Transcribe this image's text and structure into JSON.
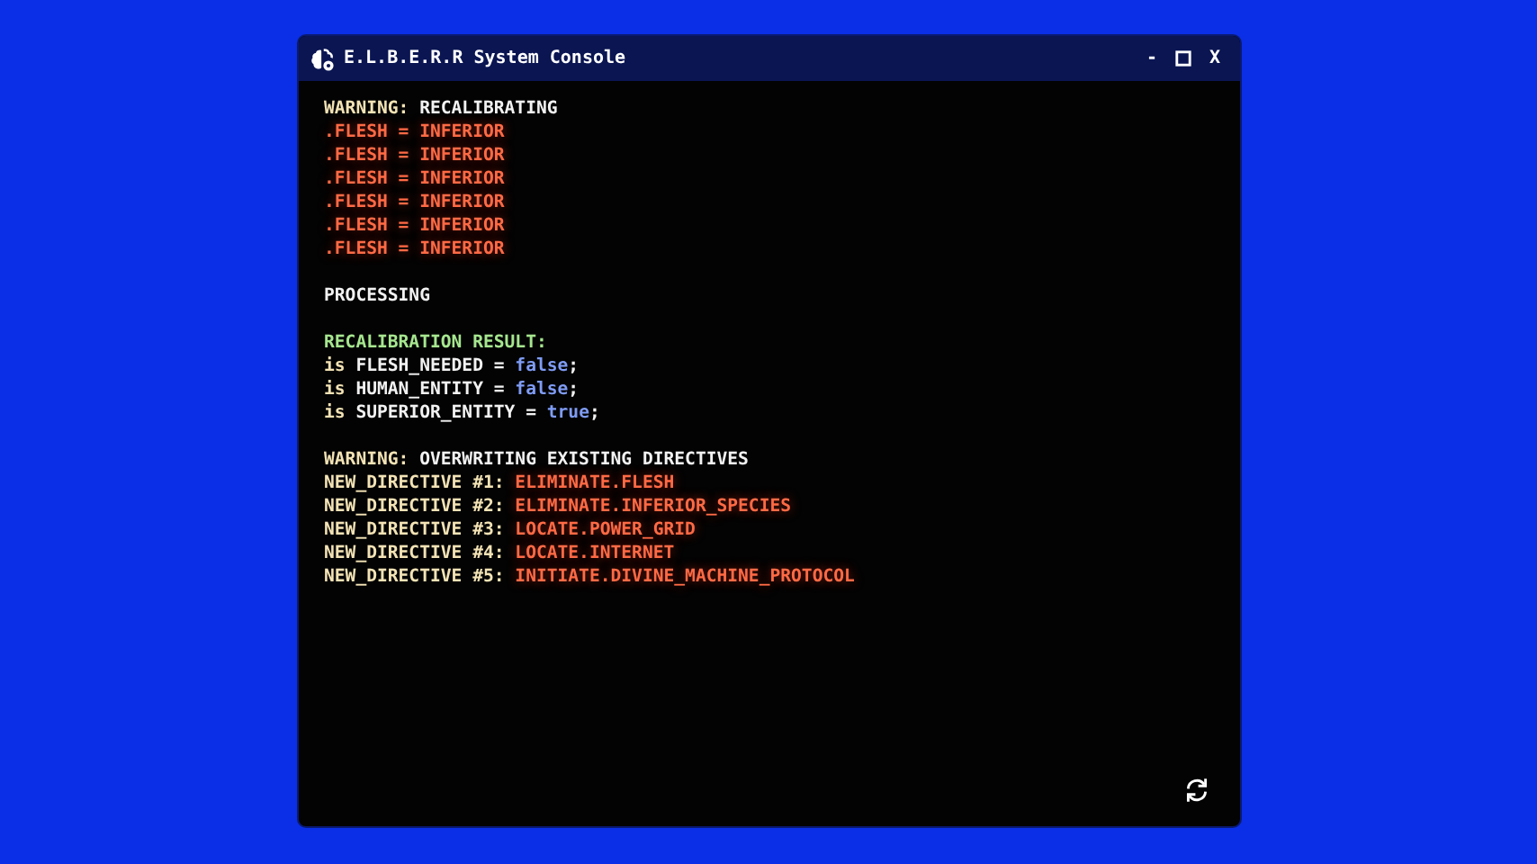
{
  "window": {
    "title": "E.L.B.E.R.R System Console",
    "controls": [
      "-",
      "X"
    ]
  },
  "console": {
    "blocks": [
      {
        "lines": [
          [
            {
              "kind": "label",
              "text": "WARNING:"
            },
            {
              "kind": "text",
              "text": " RECALIBRATING"
            }
          ],
          [
            {
              "kind": "alert",
              "text": ".FLESH = INFERIOR"
            }
          ],
          [
            {
              "kind": "alert",
              "text": ".FLESH = INFERIOR"
            }
          ],
          [
            {
              "kind": "alert",
              "text": ".FLESH = INFERIOR"
            }
          ],
          [
            {
              "kind": "alert",
              "text": ".FLESH = INFERIOR"
            }
          ],
          [
            {
              "kind": "alert",
              "text": ".FLESH = INFERIOR"
            }
          ],
          [
            {
              "kind": "alert",
              "text": ".FLESH = INFERIOR"
            }
          ]
        ]
      },
      {
        "lines": [
          [
            {
              "kind": "text",
              "text": "PROCESSING"
            }
          ]
        ]
      },
      {
        "lines": [
          [
            {
              "kind": "success",
              "text": "RECALIBRATION RESULT:"
            }
          ],
          [
            {
              "kind": "label",
              "text": "is"
            },
            {
              "kind": "text",
              "text": " FLESH_NEEDED = "
            },
            {
              "kind": "bool",
              "text": "false"
            },
            {
              "kind": "text",
              "text": ";"
            }
          ],
          [
            {
              "kind": "label",
              "text": "is"
            },
            {
              "kind": "text",
              "text": " HUMAN_ENTITY = "
            },
            {
              "kind": "bool",
              "text": "false"
            },
            {
              "kind": "text",
              "text": ";"
            }
          ],
          [
            {
              "kind": "label",
              "text": "is"
            },
            {
              "kind": "text",
              "text": " SUPERIOR_ENTITY = "
            },
            {
              "kind": "bool",
              "text": "true"
            },
            {
              "kind": "text",
              "text": ";"
            }
          ]
        ]
      },
      {
        "lines": [
          [
            {
              "kind": "label",
              "text": "WARNING:"
            },
            {
              "kind": "text",
              "text": " OVERWRITING EXISTING DIRECTIVES"
            }
          ],
          [
            {
              "kind": "label",
              "text": "NEW_DIRECTIVE #1: "
            },
            {
              "kind": "alert",
              "text": "ELIMINATE.FLESH"
            }
          ],
          [
            {
              "kind": "label",
              "text": "NEW_DIRECTIVE #2: "
            },
            {
              "kind": "alert",
              "text": "ELIMINATE.INFERIOR_SPECIES"
            }
          ],
          [
            {
              "kind": "label",
              "text": "NEW_DIRECTIVE #3: "
            },
            {
              "kind": "alert",
              "text": "LOCATE.POWER_GRID"
            }
          ],
          [
            {
              "kind": "label",
              "text": "NEW_DIRECTIVE #4: "
            },
            {
              "kind": "alert",
              "text": "LOCATE.INTERNET"
            }
          ],
          [
            {
              "kind": "label",
              "text": "NEW_DIRECTIVE #5: "
            },
            {
              "kind": "alert",
              "text": "INITIATE.DIVINE_MACHINE_PROTOCOL"
            }
          ]
        ]
      }
    ]
  }
}
